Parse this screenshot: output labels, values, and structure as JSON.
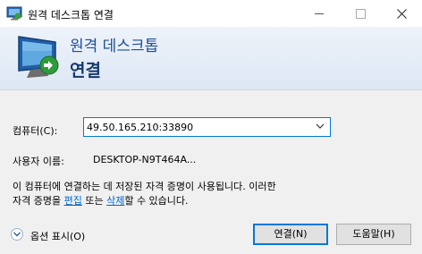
{
  "window": {
    "title": "원격 데스크톱 연결",
    "controls": [
      "minimize",
      "maximize",
      "close"
    ]
  },
  "banner": {
    "line1": "원격 데스크톱",
    "line2": "연결"
  },
  "form": {
    "computer_label": "컴퓨터(C):",
    "computer_value": "49.50.165.210:33890",
    "username_label": "사용자 이름:",
    "username_value": "DESKTOP-N9T464A..."
  },
  "info": {
    "line1": "이 컴퓨터에 연결하는 데 저장된 자격 증명이 사용됩니다. 이러한",
    "line2_prefix": "자격 증명을 ",
    "edit_link": "편집",
    "line2_mid": " 또는 ",
    "delete_link": "삭제",
    "line2_suffix": "할 수 있습니다."
  },
  "options": {
    "label": "옵션 표시(O)"
  },
  "buttons": {
    "connect": "연결(N)",
    "help": "도움말(H)"
  },
  "icons": {
    "app": "remote-desktop-icon",
    "banner": "remote-desktop-monitor-icon",
    "options": "chevron-down-circle-icon",
    "combo": "dropdown-arrow-icon"
  },
  "colors": {
    "accent": "#0078d7",
    "banner_title": "#1e4e9a",
    "link": "#0066cc"
  }
}
